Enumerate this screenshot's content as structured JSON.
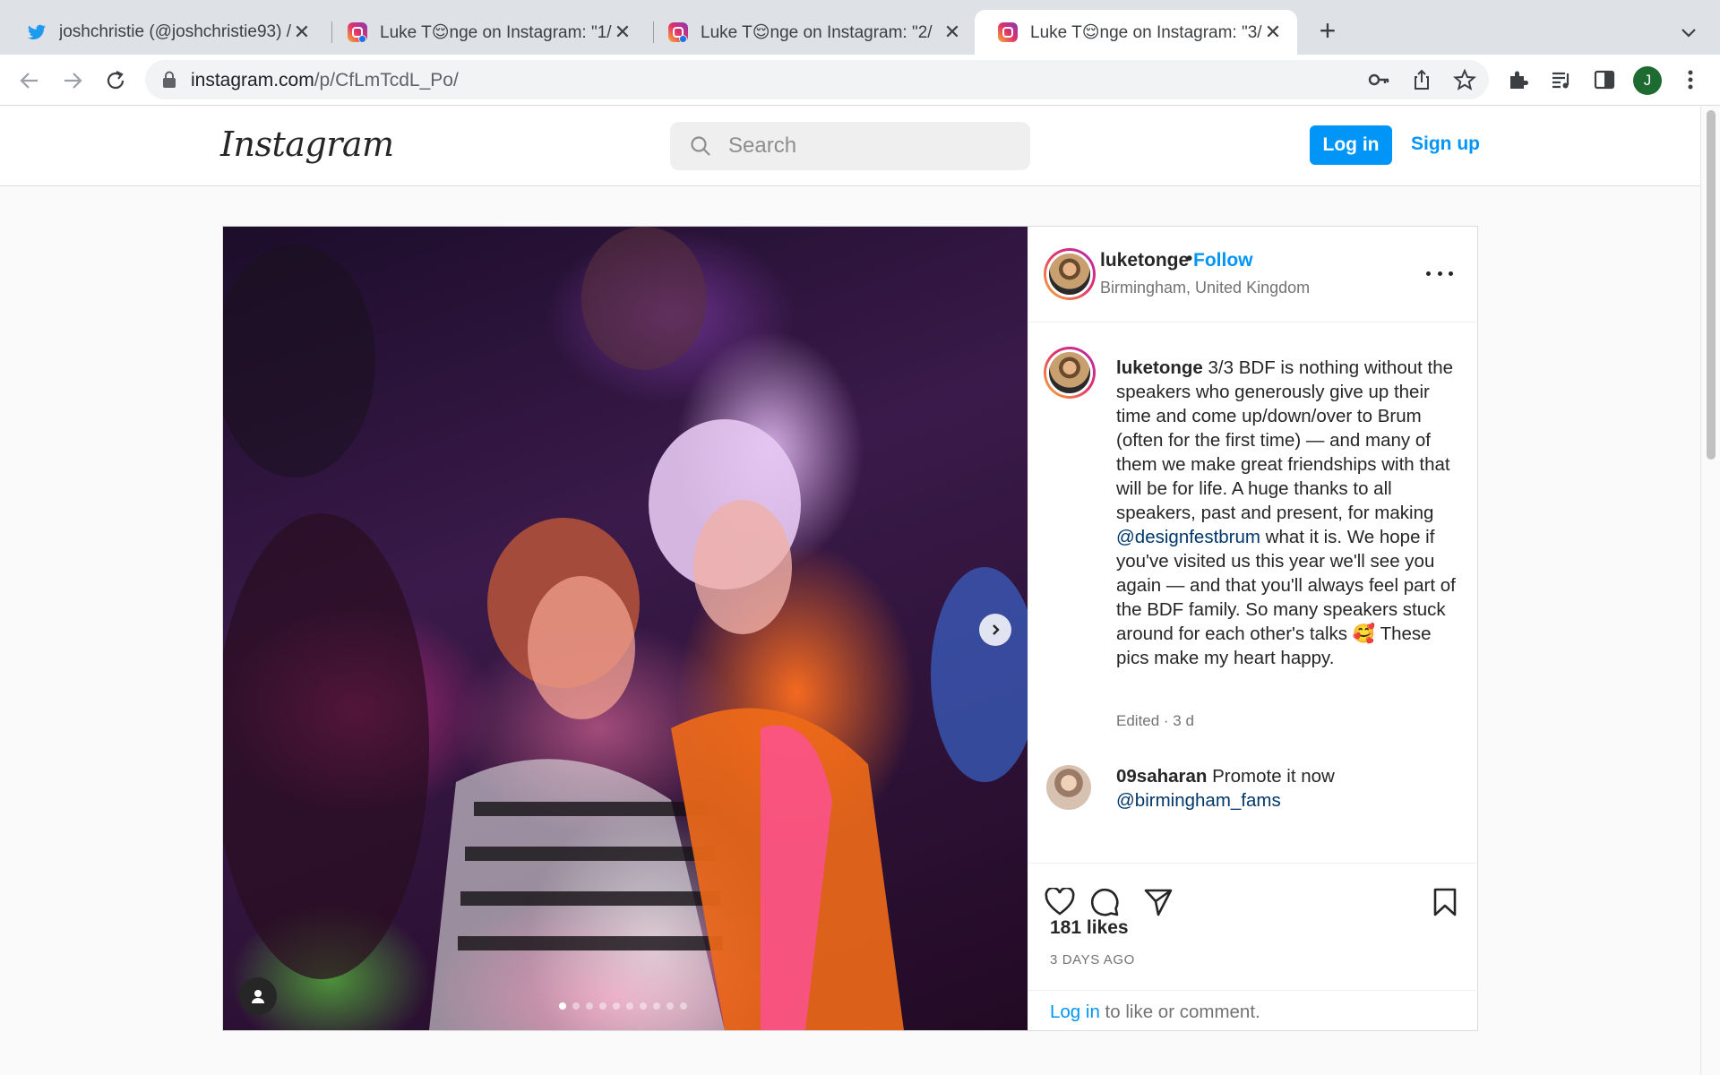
{
  "browser": {
    "tabs": [
      {
        "title": "joshchristie (@joshchristie93) / ",
        "icon": "twitter-icon",
        "active": false
      },
      {
        "title": "Luke T😌nge on Instagram: \"1/",
        "icon": "instagram-icon",
        "active": false
      },
      {
        "title": "Luke T😌nge on Instagram: \"2/",
        "icon": "instagram-icon",
        "active": false
      },
      {
        "title": "Luke T😌nge on Instagram: \"3/",
        "icon": "instagram-icon",
        "active": true
      }
    ],
    "close_glyph": "✕",
    "new_tab_glyph": "+",
    "url_domain": "instagram.com",
    "url_path": "/p/CfLmTcdL_Po/",
    "profile_initial": "J"
  },
  "header": {
    "logo": "Instagram",
    "search_placeholder": "Search",
    "login_label": "Log in",
    "signup_label": "Sign up"
  },
  "post": {
    "username": "luketonge",
    "bullet": "•",
    "follow_label": "Follow",
    "location": "Birmingham, United Kingdom",
    "caption_username": "luketonge",
    "caption_before_mention": " 3/3 BDF is nothing without the speakers who generously give up their time and come up/down/over to Brum (often for the first time) — and many of them we make great friendships with that will be for life. A huge thanks to all speakers, past and present, for making ",
    "caption_mention": "@designfestbrum",
    "caption_after_mention": " what it is. We hope if you've visited us this year we'll see you again — and that you'll always feel part of the BDF family. So many speakers stuck around for each other's talks 🥰 These pics make my heart happy.",
    "edited": "Edited · 3 d",
    "comment_username": "09saharan",
    "comment_text": " Promote it now ",
    "comment_mention": "@birmingham_fams",
    "likes": "181 likes",
    "time_ago": "3 DAYS AGO",
    "login_prompt_link": "Log in",
    "login_prompt_rest": " to like or comment.",
    "carousel": {
      "total": 10,
      "current": 1
    }
  }
}
